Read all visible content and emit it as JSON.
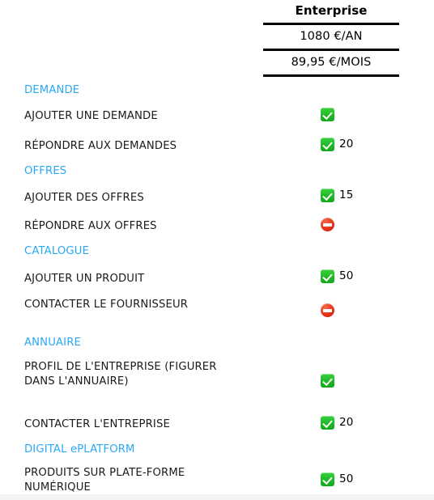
{
  "plan": {
    "name": "Enterprise",
    "price_year": "1080 €/AN",
    "price_month": "89,95 €/MOIS"
  },
  "colors": {
    "section_heading": "#2BA8F5",
    "allowed_icon": "#22bb2a",
    "denied_icon": "#e8331a",
    "text": "#000000"
  },
  "rows": [
    {
      "label": "DEMANDE",
      "type": "section",
      "icon": "",
      "value": ""
    },
    {
      "label": "AJOUTER UNE DEMANDE",
      "type": "feature",
      "icon": "check-icon",
      "value": ""
    },
    {
      "label": "RÉPONDRE AUX DEMANDES",
      "type": "feature",
      "icon": "check-icon",
      "value": "20"
    },
    {
      "label": "OFFRES",
      "type": "section",
      "icon": "",
      "value": ""
    },
    {
      "label": "AJOUTER DES OFFRES",
      "type": "feature",
      "icon": "check-icon",
      "value": "15"
    },
    {
      "label": "RÉPONDRE AUX OFFRES",
      "type": "feature",
      "icon": "no-entry-icon",
      "value": ""
    },
    {
      "label": "CATALOGUE",
      "type": "section",
      "icon": "",
      "value": ""
    },
    {
      "label": "AJOUTER UN PRODUIT",
      "type": "feature",
      "icon": "check-icon",
      "value": "50"
    },
    {
      "label": "CONTACTER LE FOURNISSEUR",
      "type": "feature",
      "icon": "no-entry-icon",
      "value": ""
    },
    {
      "label": "ANNUAIRE",
      "type": "section",
      "icon": "",
      "value": ""
    },
    {
      "label": "PROFIL DE L'ENTREPRISE (FIGURER DANS L'ANNUAIRE)",
      "type": "feature",
      "icon": "check-icon",
      "value": ""
    },
    {
      "label": "CONTACTER L'ENTREPRISE",
      "type": "feature",
      "icon": "check-icon",
      "value": "20"
    },
    {
      "label": "DIGITAL ePLATFORM",
      "type": "section",
      "icon": "",
      "value": ""
    },
    {
      "label": "PRODUITS SUR PLATE-FORME NUMÉRIQUE",
      "type": "feature",
      "icon": "check-icon",
      "value": "50"
    }
  ]
}
